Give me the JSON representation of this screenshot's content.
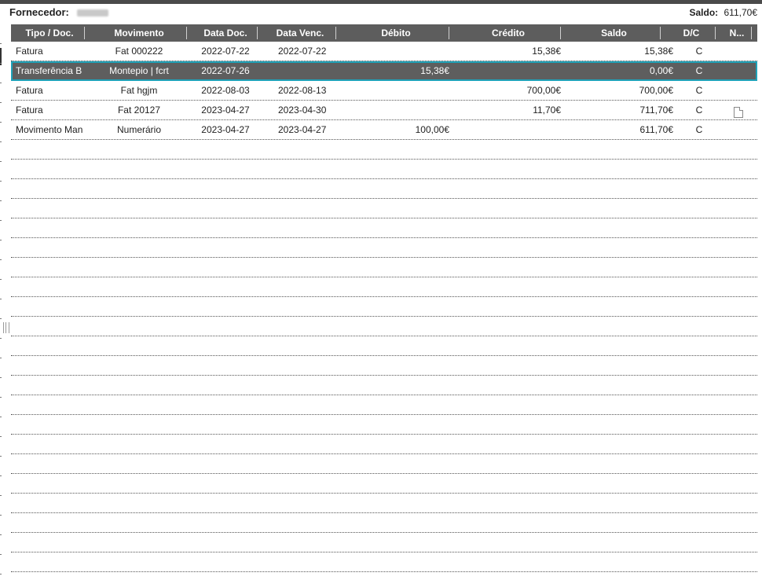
{
  "header": {
    "supplier_label": "Fornecedor:",
    "saldo_label": "Saldo:",
    "saldo_value": "611,70€"
  },
  "columns": [
    "Tipo / Doc.",
    "Movimento",
    "Data Doc.",
    "Data Venc.",
    "Débito",
    "Crédito",
    "Saldo",
    "D/C",
    "N..."
  ],
  "rows": [
    {
      "tipo": "Fatura",
      "movimento": "Fat 000222",
      "data_doc": "2022-07-22",
      "data_venc": "2022-07-22",
      "debito": "",
      "credito": "15,38€",
      "saldo": "15,38€",
      "dc": "C",
      "icon": ""
    },
    {
      "tipo": "Transferência B",
      "movimento": "Montepio | fcrt",
      "data_doc": "2022-07-26",
      "data_venc": "",
      "debito": "15,38€",
      "credito": "",
      "saldo": "0,00€",
      "dc": "C",
      "icon": ""
    },
    {
      "tipo": "Fatura",
      "movimento": "Fat hgjm",
      "data_doc": "2022-08-03",
      "data_venc": "2022-08-13",
      "debito": "",
      "credito": "700,00€",
      "saldo": "700,00€",
      "dc": "C",
      "icon": ""
    },
    {
      "tipo": "Fatura",
      "movimento": "Fat 20127",
      "data_doc": "2023-04-27",
      "data_venc": "2023-04-30",
      "debito": "",
      "credito": "11,70€",
      "saldo": "711,70€",
      "dc": "C",
      "icon": "document-icon"
    },
    {
      "tipo": "Movimento Man",
      "movimento": "Numerário",
      "data_doc": "2023-04-27",
      "data_venc": "2023-04-27",
      "debito": "100,00€",
      "credito": "",
      "saldo": "611,70€",
      "dc": "C",
      "icon": ""
    }
  ],
  "selected_row": 1,
  "empty_rows": 22,
  "colors": {
    "header_bg": "#5d5d5d",
    "selection_outline": "#1fa2b8",
    "selection_bg": "#5e5e5e"
  }
}
